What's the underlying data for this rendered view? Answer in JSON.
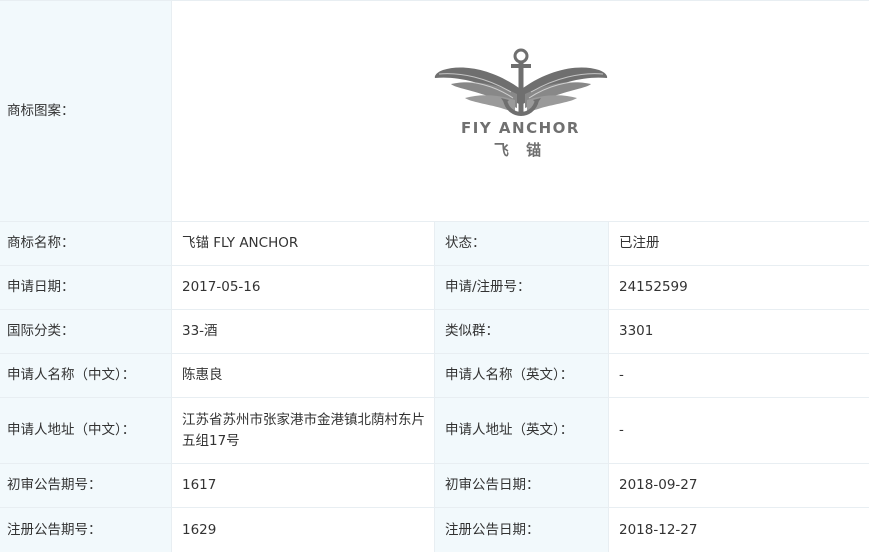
{
  "logo_row": {
    "label": "商标图案：",
    "brand_en": "FIY ANCHOR",
    "brand_zh": "飞 锚",
    "colors": {
      "mark": "#6f6f6f",
      "mark_light": "#9a9a9a"
    }
  },
  "rows": [
    {
      "l1": "商标名称：",
      "v1": "飞锚 FLY ANCHOR",
      "l2": "状态：",
      "v2": "已注册"
    },
    {
      "l1": "申请日期：",
      "v1": "2017-05-16",
      "l2": "申请/注册号：",
      "v2": "24152599"
    },
    {
      "l1": "国际分类：",
      "v1": "33-酒",
      "l2": "类似群：",
      "v2": "3301"
    },
    {
      "l1": "申请人名称（中文）：",
      "v1": "陈惠良",
      "l2": "申请人名称（英文）：",
      "v2": "-"
    },
    {
      "l1": "申请人地址（中文）：",
      "v1": "江苏省苏州市张家港市金港镇北荫村东片五组17号",
      "l2": "申请人地址（英文）：",
      "v2": "-"
    },
    {
      "l1": "初审公告期号：",
      "v1": "1617",
      "l2": "初审公告日期：",
      "v2": "2018-09-27"
    },
    {
      "l1": "注册公告期号：",
      "v1": "1629",
      "l2": "注册公告日期：",
      "v2": "2018-12-27"
    }
  ],
  "theme": {
    "label_bg": "#f2f9fc",
    "border": "#e8eef2",
    "text": "#333333"
  }
}
